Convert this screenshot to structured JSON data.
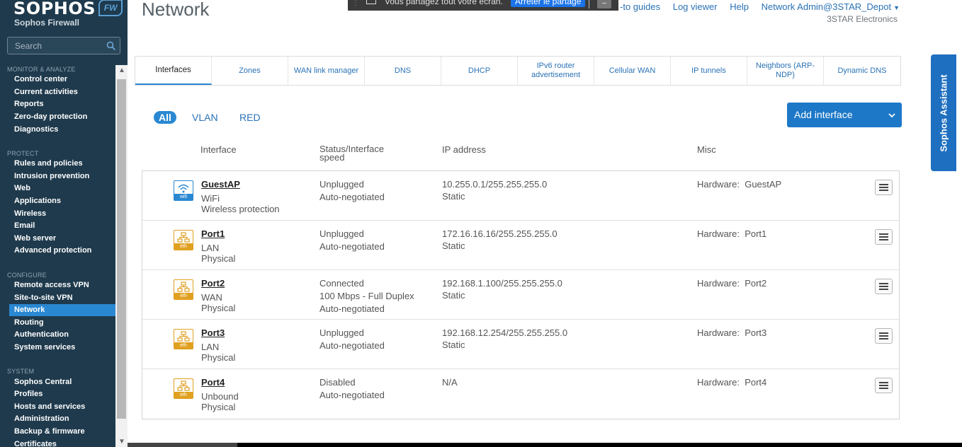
{
  "sidebar": {
    "brand": "SOPHOS",
    "badge": "FW",
    "product": "Sophos Firewall",
    "search_placeholder": "Search",
    "sections": [
      {
        "label": "MONITOR & ANALYZE",
        "items": [
          "Control center",
          "Current activities",
          "Reports",
          "Zero-day protection",
          "Diagnostics"
        ]
      },
      {
        "label": "PROTECT",
        "items": [
          "Rules and policies",
          "Intrusion prevention",
          "Web",
          "Applications",
          "Wireless",
          "Email",
          "Web server",
          "Advanced protection"
        ]
      },
      {
        "label": "CONFIGURE",
        "items": [
          "Remote access VPN",
          "Site-to-site VPN",
          "Network",
          "Routing",
          "Authentication",
          "System services"
        ]
      },
      {
        "label": "SYSTEM",
        "items": [
          "Sophos Central",
          "Profiles",
          "Hosts and services",
          "Administration",
          "Backup & firmware",
          "Certificates"
        ]
      }
    ],
    "active_item": "Network"
  },
  "header": {
    "title": "Network",
    "screenshare_message": "Vous partagez tout votre écran.",
    "screenshare_stop": "Arrêter le partage",
    "links": [
      "-to guides",
      "Log viewer",
      "Help",
      "Network Admin@3STAR_Depot"
    ],
    "company": "3STAR Electronics"
  },
  "tabs": [
    {
      "label": "Interfaces",
      "active": true
    },
    {
      "label": "Zones"
    },
    {
      "label": "WAN link manager"
    },
    {
      "label": "DNS"
    },
    {
      "label": "DHCP"
    },
    {
      "label": "IPv6 router advertisement"
    },
    {
      "label": "Cellular WAN"
    },
    {
      "label": "IP tunnels"
    },
    {
      "label": "Neighbors (ARP-NDP)"
    },
    {
      "label": "Dynamic DNS"
    }
  ],
  "filters": [
    "All",
    "VLAN",
    "RED"
  ],
  "add_button": "Add interface",
  "columns": {
    "interface": "Interface",
    "status": "Status/Interface speed",
    "ip": "IP address",
    "misc": "Misc"
  },
  "rows": [
    {
      "icon": "wifi",
      "icon_tag": "wifi",
      "name": "GuestAP",
      "sub1": "WiFi",
      "sub2": "Wireless protection",
      "status": [
        "Unplugged",
        "Auto-negotiated"
      ],
      "ip": [
        "10.255.0.1/255.255.255.0",
        "Static"
      ],
      "misc_label": "Hardware:",
      "misc_value": "GuestAP"
    },
    {
      "icon": "eth",
      "icon_tag": "eth",
      "name": "Port1",
      "sub1": "LAN",
      "sub2": "Physical",
      "status": [
        "Unplugged",
        "Auto-negotiated"
      ],
      "ip": [
        "172.16.16.16/255.255.255.0",
        "Static"
      ],
      "misc_label": "Hardware:",
      "misc_value": "Port1"
    },
    {
      "icon": "eth",
      "icon_tag": "eth",
      "name": "Port2",
      "sub1": "WAN",
      "sub2": "Physical",
      "status": [
        "Connected",
        "100 Mbps - Full Duplex",
        "Auto-negotiated"
      ],
      "ip": [
        "192.168.1.100/255.255.255.0",
        "Static"
      ],
      "misc_label": "Hardware:",
      "misc_value": "Port2"
    },
    {
      "icon": "eth",
      "icon_tag": "eth",
      "name": "Port3",
      "sub1": "LAN",
      "sub2": "Physical",
      "status": [
        "Unplugged",
        "Auto-negotiated"
      ],
      "ip": [
        "192.168.12.254/255.255.255.0",
        "Static"
      ],
      "misc_label": "Hardware:",
      "misc_value": "Port3"
    },
    {
      "icon": "eth",
      "icon_tag": "eth",
      "name": "Port4",
      "sub1": "Unbound",
      "sub2": "Physical",
      "status": [
        "Disabled",
        "Auto-negotiated"
      ],
      "ip": [
        "N/A"
      ],
      "misc_label": "Hardware:",
      "misc_value": "Port4"
    }
  ],
  "assistant": "Sophos Assistant",
  "colors": {
    "sidebar": "#1f3a4d",
    "accent": "#2a88d2",
    "link": "#2a72b5",
    "eth": "#e0a020"
  }
}
